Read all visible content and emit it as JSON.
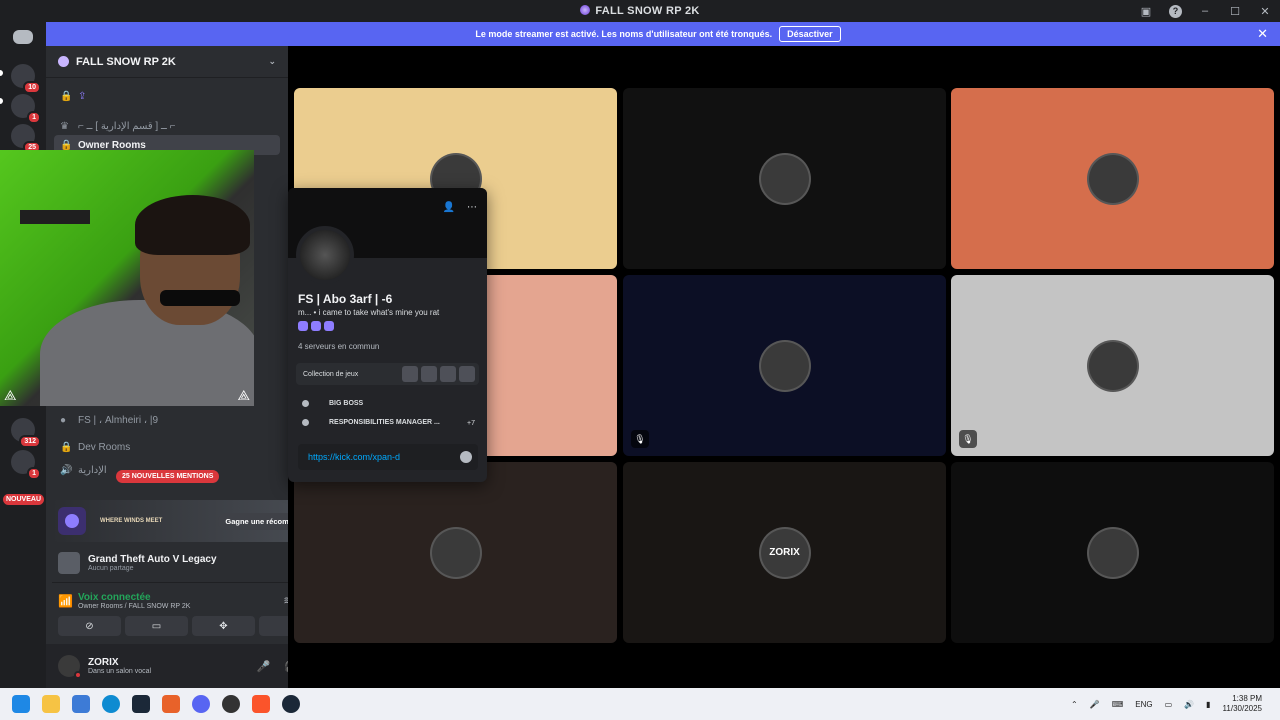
{
  "window": {
    "title": "FALL SNOW RP 2K"
  },
  "streamer_banner": {
    "message": "Le mode streamer est activé. Les noms d'utilisateur ont été tronqués.",
    "button": "Désactiver"
  },
  "rail": {
    "badges": [
      "10",
      "1",
      "25",
      "312",
      "1"
    ],
    "new_label": "NOUVEAU"
  },
  "server": {
    "name": "FALL SNOW RP 2K",
    "channels": [
      {
        "label": "⌐ ــ [ قسم الإدارية ] ــ ⌐",
        "kind": "category"
      },
      {
        "label": "Owner Rooms",
        "kind": "voice",
        "active": true
      },
      {
        "label": "FS | ، Almheiri ، |9",
        "kind": "user"
      },
      {
        "label": "Dev Rooms",
        "kind": "voice"
      },
      {
        "label": "الإدارية",
        "kind": "voice"
      }
    ],
    "mentions": "25 NOUVELLES MENTIONS"
  },
  "promo": {
    "brand": "WHERE WINDS MEET",
    "reward": "Gagne une récompense !"
  },
  "activity": {
    "game": "Grand Theft Auto V Legacy",
    "status": "Aucun partage"
  },
  "voice": {
    "status": "Voix connectée",
    "channel": "Owner Rooms / FALL SNOW RP 2K"
  },
  "user": {
    "name": "ZORIX",
    "status": "Dans un salon vocal"
  },
  "profile": {
    "name": "FS | Abo 3arf | -6",
    "bio": "m... • i came to take what's mine you rat",
    "mutual": "4 serveurs en commun",
    "games_label": "Collection de jeux",
    "roles": [
      "BIG BOSS",
      "RESPONSIBILITIES MANAGER ..."
    ],
    "more_roles": "+7",
    "message_input": "https://kick.com/xpan-d"
  },
  "tiles": [
    {
      "color": "#ebcd8f",
      "label": ""
    },
    {
      "color": "#111111",
      "label": ""
    },
    {
      "color": "#d56e4c",
      "label": ""
    },
    {
      "color": "#e4a590",
      "label": ""
    },
    {
      "color": "#0c0f25",
      "label": ""
    },
    {
      "color": "#c4c4c4",
      "label": ""
    },
    {
      "color": "#2a221f",
      "label": ""
    },
    {
      "color": "#191614",
      "label": "ZORIX"
    },
    {
      "color": "#0e0e0e",
      "label": ""
    }
  ],
  "taskbar": {
    "lang": "ENG",
    "time": "1:38 PM",
    "date": "11/30/2025"
  }
}
